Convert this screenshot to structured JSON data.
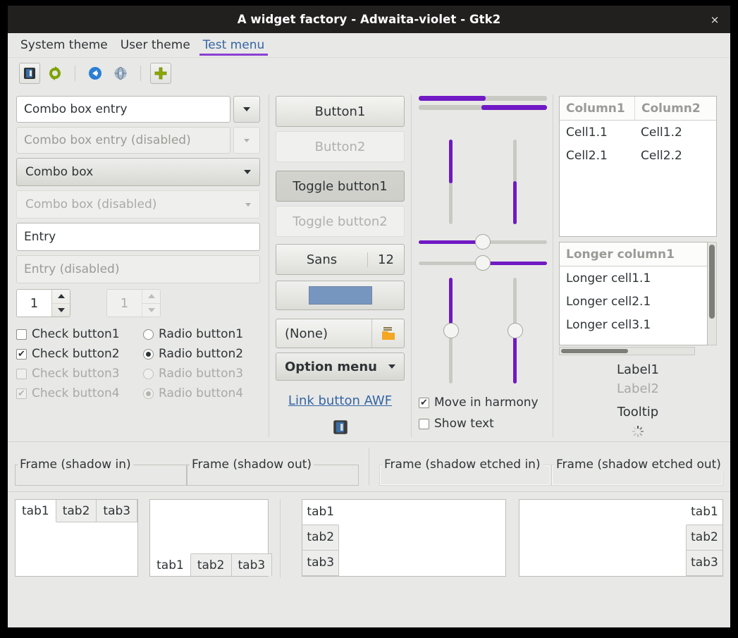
{
  "window": {
    "title": "A widget factory - Adwaita-violet - Gtk2",
    "close_label": "×"
  },
  "menubar": {
    "items": [
      {
        "label": "System theme",
        "active": false
      },
      {
        "label": "User theme",
        "active": false
      },
      {
        "label": "Test menu",
        "active": true
      }
    ]
  },
  "toolbar": {
    "buttons": [
      {
        "name": "app-icon",
        "label": ""
      },
      {
        "name": "refresh-icon",
        "label": ""
      },
      {
        "name": "back-icon",
        "label": ""
      },
      {
        "name": "network-icon",
        "label": ""
      },
      {
        "name": "add-icon",
        "label": ""
      }
    ]
  },
  "left_column": {
    "combo_box_entry": {
      "value": "Combo box entry"
    },
    "combo_box_entry_disabled": {
      "value": "Combo box entry (disabled)"
    },
    "combo_box": {
      "value": "Combo box"
    },
    "combo_box_disabled": {
      "value": "Combo box (disabled)"
    },
    "entry": {
      "value": "Entry"
    },
    "entry_disabled": {
      "value": "Entry (disabled)"
    },
    "spin_button": {
      "value": "1"
    },
    "spin_button_disabled": {
      "value": "1"
    },
    "checks": [
      {
        "label": "Check button1",
        "checked": false,
        "disabled": false
      },
      {
        "label": "Check button2",
        "checked": true,
        "disabled": false
      },
      {
        "label": "Check button3",
        "checked": false,
        "disabled": true
      },
      {
        "label": "Check button4",
        "checked": true,
        "disabled": true
      }
    ],
    "radios": [
      {
        "label": "Radio button1",
        "checked": false,
        "disabled": false
      },
      {
        "label": "Radio button2",
        "checked": true,
        "disabled": false
      },
      {
        "label": "Radio button3",
        "checked": false,
        "disabled": true
      },
      {
        "label": "Radio button4",
        "checked": true,
        "disabled": true
      }
    ]
  },
  "button_column": {
    "button1": "Button1",
    "button2": "Button2",
    "toggle1": "Toggle button1",
    "toggle2": "Toggle button2",
    "font_name": "Sans",
    "font_size": "12",
    "color_value": "#7796bf",
    "file_button": "(None)",
    "option_menu": "Option menu",
    "link_button": "Link button AWF"
  },
  "scale_column": {
    "progress_top_percent": 52,
    "progress_bottom_percent": 49,
    "vertical_top": [
      {
        "name": "vscale-1",
        "fill_percent": 52,
        "inverted": false
      },
      {
        "name": "vscale-2",
        "fill_percent": 51,
        "inverted": true
      }
    ],
    "h_scale_1": {
      "value_percent": 50,
      "inverted": false
    },
    "h_scale_2": {
      "value_percent": 50,
      "inverted": true
    },
    "v_scale_1": {
      "value_percent": 50,
      "inverted": false
    },
    "v_scale_2": {
      "value_percent": 50,
      "inverted": true
    },
    "checks": [
      {
        "label": "Move in harmony",
        "checked": true
      },
      {
        "label": "Show text",
        "checked": false
      }
    ]
  },
  "tree_column": {
    "table1": {
      "headers": [
        "Column1",
        "Column2"
      ],
      "rows": [
        [
          "Cell1.1",
          "Cell1.2"
        ],
        [
          "Cell2.1",
          "Cell2.2"
        ]
      ]
    },
    "table2": {
      "header": "Longer column1",
      "rows": [
        "Longer cell1.1",
        "Longer cell2.1",
        "Longer cell3.1"
      ]
    },
    "label1": "Label1",
    "label2": "Label2",
    "tooltip": "Tooltip"
  },
  "frames": [
    {
      "label": "Frame (shadow in)",
      "style": "in"
    },
    {
      "label": "Frame (shadow out)",
      "style": "out"
    },
    {
      "label": "Frame (shadow etched in)",
      "style": "etched-in"
    },
    {
      "label": "Frame (shadow etched out)",
      "style": "etched-out"
    }
  ],
  "notebooks": [
    {
      "name": "notebook-tabs-top",
      "tabs": [
        "tab1",
        "tab2",
        "tab3"
      ],
      "selected": 0
    },
    {
      "name": "notebook-tabs-bottom",
      "tabs": [
        "tab1",
        "tab2",
        "tab3"
      ],
      "selected": 0
    },
    {
      "name": "notebook-tabs-left",
      "tabs": [
        "tab1",
        "tab2",
        "tab3"
      ],
      "selected": 0
    },
    {
      "name": "notebook-tabs-right",
      "tabs": [
        "tab1",
        "tab2",
        "tab3"
      ],
      "selected": 0
    }
  ],
  "colors": {
    "accent_violet": "#7019c4",
    "link_blue": "#3465a4",
    "titlebar_bg": "#221f1f",
    "window_bg": "#e8e8e6"
  }
}
